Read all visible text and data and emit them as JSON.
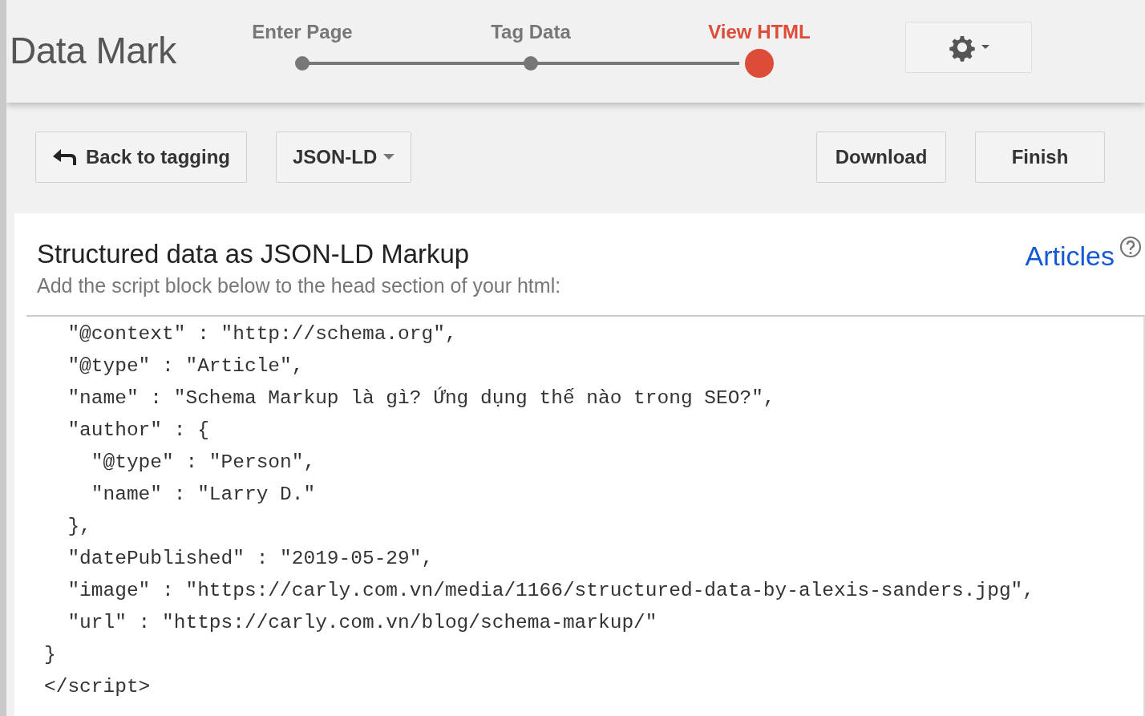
{
  "app_title": "Data Mark",
  "steps": [
    {
      "label": "Enter Page",
      "selected": false
    },
    {
      "label": "Tag Data",
      "selected": false
    },
    {
      "label": "View HTML",
      "selected": true
    }
  ],
  "toolbar": {
    "back_button": "Back to tagging",
    "format_dropdown": "JSON-LD",
    "buttons": [
      "Download",
      "Finish"
    ]
  },
  "panel": {
    "title": "Structured data as JSON-LD Markup",
    "subtitle": "Add the script block below to the head section of your html:",
    "type_link": "Articles"
  },
  "code_lines": [
    "  \"@context\" : \"http://schema.org\",",
    "  \"@type\" : \"Article\",",
    "  \"name\" : \"Schema Markup là gì? Ứng dụng thế nào trong SEO?\",",
    "  \"author\" : {",
    "    \"@type\" : \"Person\",",
    "    \"name\" : \"Larry D.\"",
    "  },",
    "  \"datePublished\" : \"2019-05-29\",",
    "  \"image\" : \"https://carly.com.vn/media/1166/structured-data-by-alexis-sanders.jpg\",",
    "  \"url\" : \"https://carly.com.vn/blog/schema-markup/\"",
    "}",
    "</script>"
  ]
}
